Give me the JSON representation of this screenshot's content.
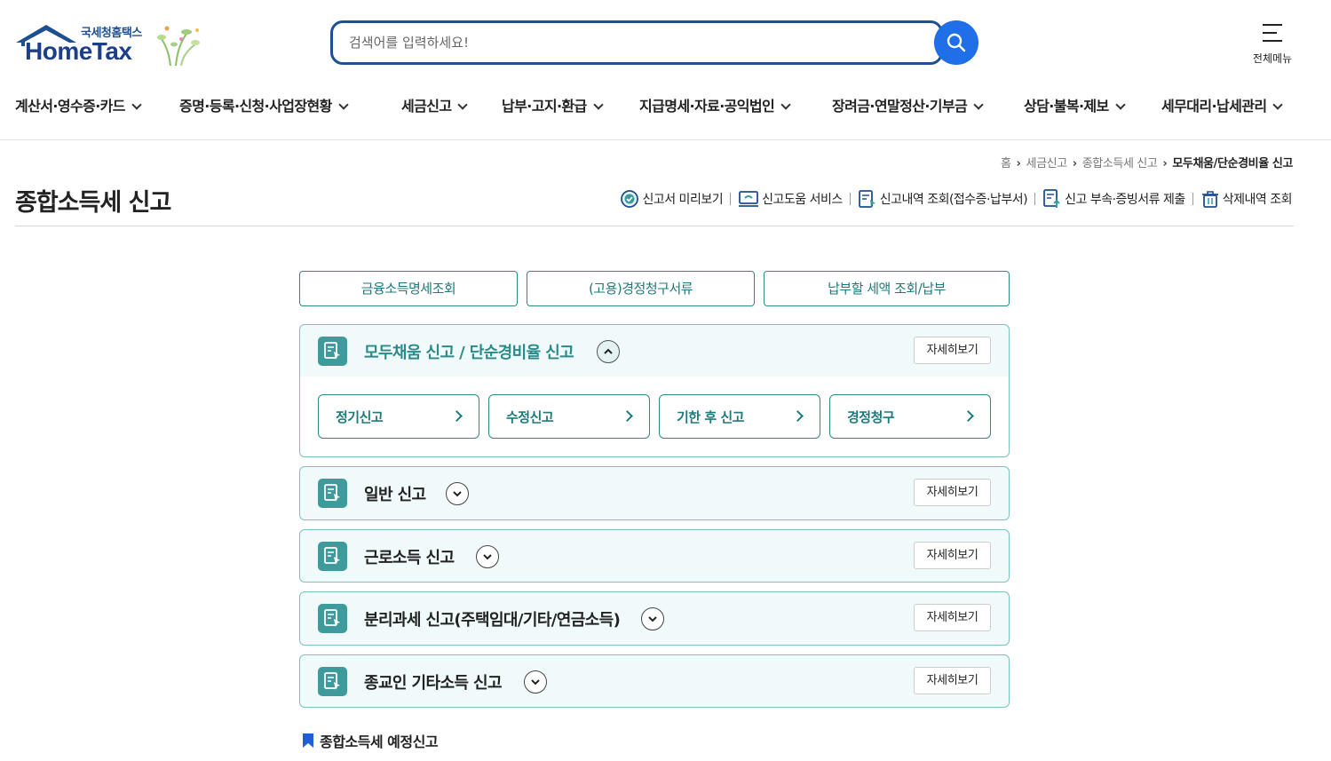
{
  "colors": {
    "primary_blue": "#1d4f91",
    "search_button": "#1e6fe8",
    "teal": "#2a8a8a",
    "accordion_bg": "#f1fafa"
  },
  "header": {
    "logo_sub": "국세청홈택스",
    "logo_main": "HomeTax",
    "search_placeholder": "검색어를 입력하세요!",
    "all_menu_label": "전체메뉴"
  },
  "gnb": [
    {
      "label": "계산서·영수증·카드"
    },
    {
      "label": "증명·등록·신청·사업장현황"
    },
    {
      "label": "세금신고"
    },
    {
      "label": "납부·고지·환급"
    },
    {
      "label": "지급명세·자료·공익법인"
    },
    {
      "label": "장려금·연말정산·기부금"
    },
    {
      "label": "상담·불복·제보"
    },
    {
      "label": "세무대리·납세관리"
    }
  ],
  "breadcrumb": [
    "홈",
    "세금신고",
    "종합소득세 신고",
    "모두채움/단순경비율 신고"
  ],
  "page_title": "종합소득세 신고",
  "quick_links": [
    {
      "label": "신고서 미리보기",
      "icon": "check-circle-icon"
    },
    {
      "label": "신고도움 서비스",
      "icon": "monitor-icon"
    },
    {
      "label": "신고내역 조회(접수증·납부서)",
      "icon": "document-search-icon"
    },
    {
      "label": "신고 부속·증빙서류 제출",
      "icon": "document-upload-icon"
    },
    {
      "label": "삭제내역 조회",
      "icon": "trash-icon"
    }
  ],
  "top_buttons": [
    "금융소득명세조회",
    "(고용)경정청구서류",
    "납부할 세액 조회/납부"
  ],
  "accordions": [
    {
      "title": "모두채움 신고 / 단순경비율 신고",
      "expanded": true,
      "detail_label": "자세히보기",
      "sub_items": [
        "정기신고",
        "수정신고",
        "기한 후 신고",
        "경정청구"
      ]
    },
    {
      "title": "일반 신고",
      "expanded": false,
      "detail_label": "자세히보기"
    },
    {
      "title": "근로소득 신고",
      "expanded": false,
      "detail_label": "자세히보기"
    },
    {
      "title": "분리과세 신고(주택임대/기타/연금소득)",
      "expanded": false,
      "detail_label": "자세히보기"
    },
    {
      "title": "종교인 기타소득 신고",
      "expanded": false,
      "detail_label": "자세히보기"
    }
  ],
  "section_heading": "종합소득세 예정신고"
}
